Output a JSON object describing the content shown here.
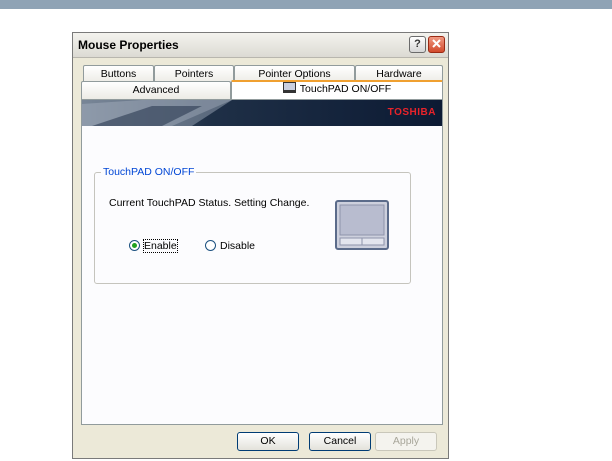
{
  "window": {
    "title": "Mouse Properties",
    "help_label": "?"
  },
  "tabs": {
    "buttons": "Buttons",
    "pointers": "Pointers",
    "pointer_options": "Pointer Options",
    "hardware": "Hardware",
    "advanced": "Advanced",
    "touchpad": "TouchPAD ON/OFF"
  },
  "banner": {
    "brand": "TOSHIBA"
  },
  "group": {
    "title": "TouchPAD ON/OFF",
    "status_text": "Current TouchPAD Status. Setting Change."
  },
  "options": {
    "enable_label": "Enable",
    "disable_label": "Disable",
    "selected": "Enable"
  },
  "footer": {
    "ok_label": "OK",
    "cancel_label": "Cancel",
    "apply_label": "Apply"
  },
  "colors": {
    "accent_tab": "#f0a030",
    "brand_red": "#e8232a",
    "group_title_blue": "#0046d5"
  }
}
